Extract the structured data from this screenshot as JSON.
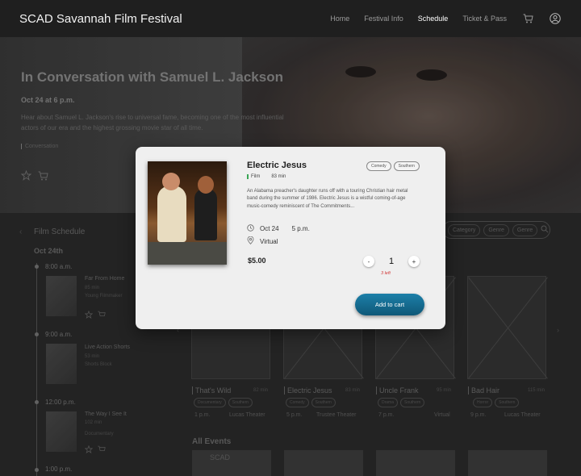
{
  "header": {
    "brand": "SCAD Savannah Film Festival",
    "nav": [
      "Home",
      "Festival Info",
      "Schedule",
      "Ticket & Pass"
    ],
    "active_nav": "Schedule"
  },
  "hero": {
    "title": "In Conversation with Samuel L. Jackson",
    "date": "Oct 24 at 6 p.m.",
    "description": "Hear about Samuel L. Jackson's rise to universal fame, becoming one of the most influential actors of our era and the highest grossing movie star of all time.",
    "tag": "Conversation"
  },
  "schedule": {
    "title": "Film Schedule",
    "date": "Oct 24th",
    "slots": [
      {
        "time": "8:00 a.m.",
        "film": "Far From Home",
        "minutes": "85 min",
        "tags": "Young Filmmaker"
      },
      {
        "time": "9:00 a.m.",
        "film": "Live Action Shorts",
        "minutes": "53 min",
        "tags": "Shorts Block"
      },
      {
        "time": "12:00 p.m.",
        "film": "The Way I See It",
        "minutes": "102 min",
        "tags": "Documentary"
      },
      {
        "time": "1:00 p.m."
      }
    ]
  },
  "filters": [
    "Category",
    "Genre",
    "Genre"
  ],
  "cards": [
    {
      "name": "That's Wild",
      "minutes": "82 min",
      "tags": [
        "Documentary",
        "Southern"
      ],
      "time": "1 p.m.",
      "location": "Lucas Theater"
    },
    {
      "name": "Electric Jesus",
      "minutes": "83 min",
      "tags": [
        "Comedy",
        "Southern"
      ],
      "time": "5 p.m.",
      "location": "Trustee Theater"
    },
    {
      "name": "Uncle Frank",
      "minutes": "95 min",
      "tags": [
        "Drama",
        "Southern"
      ],
      "time": "7 p.m.",
      "location": "Virtual"
    },
    {
      "name": "Bad Hair",
      "minutes": "115 min",
      "tags": [
        "Horror",
        "Southern"
      ],
      "time": "9 p.m.",
      "location": "Lucas Theater"
    }
  ],
  "all_events": {
    "title": "All Events",
    "thumb_text": "SCAD"
  },
  "modal": {
    "title": "Electric Jesus",
    "tags": [
      "Comedy",
      "Southern"
    ],
    "category": "Film",
    "minutes": "83 min",
    "description": "An Alabama preacher's daughter runs off with a touring Christian hair metal band during the summer of 1986. Electric Jesus is a wistful coming-of-age music-comedy reminiscent of The Commitments...",
    "date": "Oct 24",
    "time": "5 p.m.",
    "location": "Virtual",
    "price": "$5.00",
    "quantity": "1",
    "minus": "-",
    "plus": "+",
    "left_note": "3 left",
    "add_button": "Add to cart"
  },
  "colors": {
    "accent_button": "#1c7fa8",
    "category_bar": "#3aa655",
    "warning_text": "#d23a3a"
  }
}
